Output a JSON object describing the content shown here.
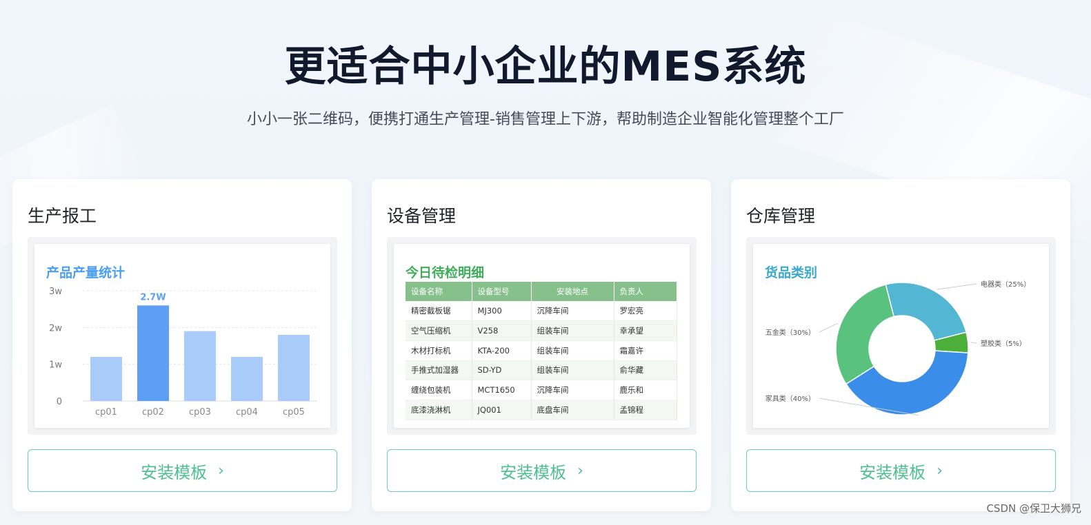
{
  "hero": {
    "title": "更适合中小企业的MES系统",
    "subtitle": "小小一张二维码，便携打通生产管理-销售管理上下游，帮助制造企业智能化管理整个工厂"
  },
  "cards": [
    {
      "title": "生产报工",
      "panel_title": "产品产量统计",
      "button_label": "安装模板",
      "button_icon": "chevron-right-icon"
    },
    {
      "title": "设备管理",
      "panel_title": "今日待检明细",
      "button_label": "安装模板",
      "button_icon": "chevron-right-icon"
    },
    {
      "title": "仓库管理",
      "panel_title": "货品类别",
      "button_label": "安装模板",
      "button_icon": "chevron-right-icon"
    }
  ],
  "chart_data": [
    {
      "type": "bar",
      "title": "产品产量统计",
      "categories": [
        "cp01",
        "cp02",
        "cp03",
        "cp04",
        "cp05"
      ],
      "values": [
        1.2,
        2.6,
        1.9,
        1.2,
        1.8
      ],
      "y_tick_labels": [
        "0",
        "1w",
        "2w",
        "3w"
      ],
      "ylim": [
        0,
        3
      ],
      "highlight_index": 1,
      "highlight_label": "2.7W",
      "colors": {
        "bar": "#a8cbfa",
        "highlight": "#5e9ff4",
        "title": "#4a9ff0"
      },
      "grid": true
    },
    {
      "type": "pie",
      "title": "货品类别",
      "donut": true,
      "slices": [
        {
          "name": "电器类（25%）",
          "value": 25,
          "color": "#53b6d3"
        },
        {
          "name": "塑胶类（5%）",
          "value": 5,
          "color": "#4caf3a"
        },
        {
          "name": "家具类（40%）",
          "value": 40,
          "color": "#3a8de8"
        },
        {
          "name": "五金类（30%）",
          "value": 30,
          "color": "#5ac27f"
        }
      ],
      "colors": {
        "title": "#3aa8cf"
      }
    }
  ],
  "equipment_table": {
    "title_color": "#3fae5a",
    "headers": [
      "设备名称",
      "设备型号",
      "安装地点",
      "负责人"
    ],
    "rows": [
      [
        "精密截板锯",
        "MJ300",
        "沉降车间",
        "罗宏亮"
      ],
      [
        "空气压缩机",
        "V258",
        "组装车间",
        "幸承望"
      ],
      [
        "木材打标机",
        "KTA-200",
        "组装车间",
        "霜嘉许"
      ],
      [
        "手推式加湿器",
        "SD-YD",
        "组装车间",
        "俞华藏"
      ],
      [
        "缠绕包装机",
        "MCT1650",
        "沉降车间",
        "鹿乐和"
      ],
      [
        "底漆浇淋机",
        "JQ001",
        "底盘车间",
        "孟锦程"
      ]
    ]
  },
  "watermark": "CSDN @保卫大狮兄"
}
